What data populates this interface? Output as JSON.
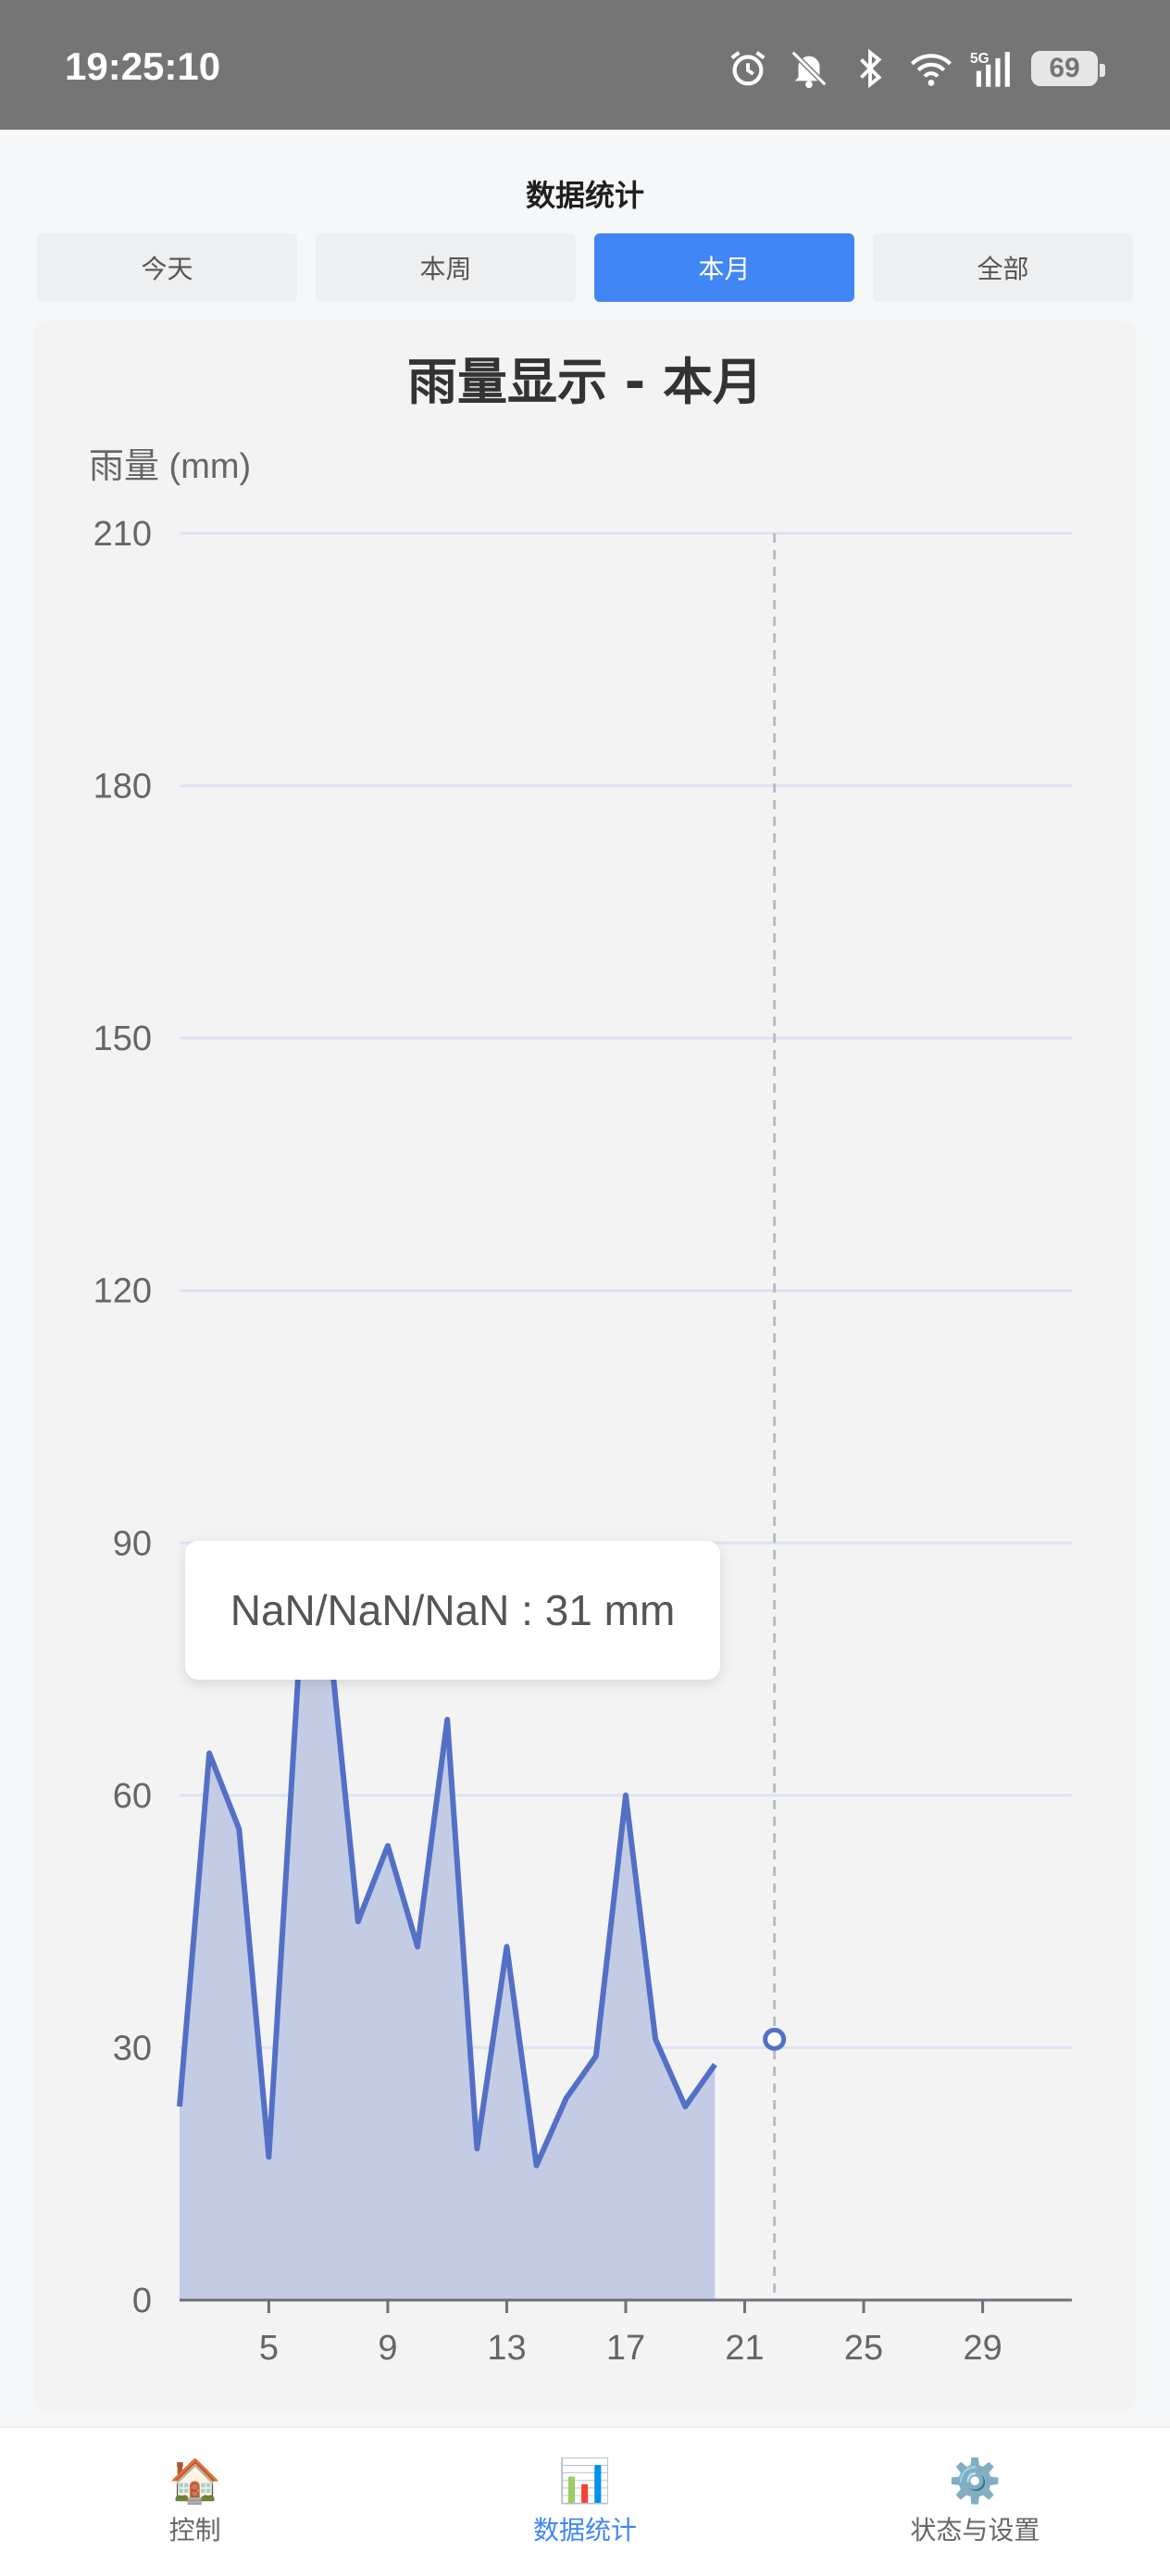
{
  "status_bar": {
    "time": "19:25:10",
    "battery": "69",
    "icons": [
      "alarm-icon",
      "mute-icon",
      "bluetooth-icon",
      "wifi-icon",
      "signal-5g-icon",
      "battery-icon"
    ]
  },
  "page": {
    "title": "数据统计"
  },
  "tabs": [
    {
      "label": "今天",
      "active": false
    },
    {
      "label": "本周",
      "active": false
    },
    {
      "label": "本月",
      "active": true
    },
    {
      "label": "全部",
      "active": false
    }
  ],
  "tooltip": {
    "text": "NaN/NaN/NaN : 31 mm"
  },
  "chart_data": {
    "type": "area",
    "title": "雨量显示 - 本月",
    "ylabel": "雨量 (mm)",
    "ylim": [
      0,
      210
    ],
    "yticks": [
      0,
      30,
      60,
      90,
      120,
      150,
      180,
      210
    ],
    "xlim": [
      2,
      32
    ],
    "xticks": [
      5,
      9,
      13,
      17,
      21,
      25,
      29
    ],
    "x": [
      2,
      3,
      4,
      5,
      6,
      7,
      8,
      9,
      10,
      11,
      12,
      13,
      14,
      15,
      16,
      17,
      18,
      19,
      20
    ],
    "values": [
      23,
      65,
      56,
      17,
      75,
      80,
      45,
      54,
      42,
      69,
      18,
      42,
      16,
      24,
      29,
      60,
      31,
      23,
      28
    ],
    "highlight": {
      "x": 22,
      "y": 31
    },
    "color": "#5470c6",
    "fill_color": "#c3cce4",
    "grid_color": "#dde2f3"
  },
  "bottom_nav": [
    {
      "label": "控制",
      "icon": "🏠",
      "active": false
    },
    {
      "label": "数据统计",
      "icon": "📊",
      "active": true
    },
    {
      "label": "状态与设置",
      "icon": "⚙️",
      "active": false
    }
  ]
}
